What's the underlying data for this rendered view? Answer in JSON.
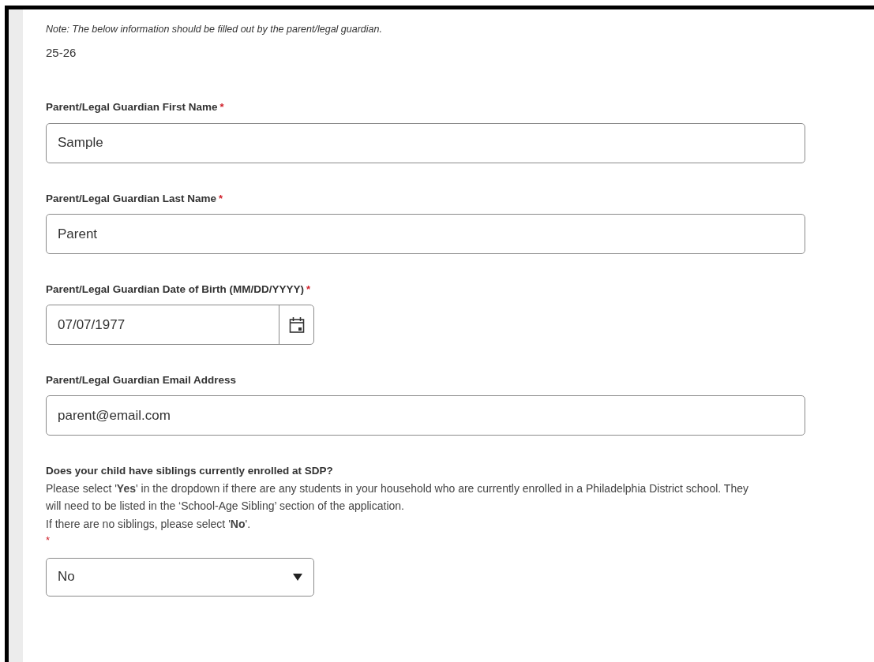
{
  "note": "Note: The below information should be filled out by the parent/legal guardian.",
  "year": "25-26",
  "fields": [
    {
      "kind": "text",
      "label": "Parent/Legal Guardian First Name",
      "required_mark": "*",
      "value": "Sample"
    },
    {
      "kind": "text",
      "label": "Parent/Legal Guardian Last Name",
      "required_mark": "*",
      "value": "Parent"
    },
    {
      "kind": "date",
      "label": "Parent/Legal Guardian Date of Birth (MM/DD/YYYY)",
      "required_mark": "*",
      "value": "07/07/1977"
    },
    {
      "kind": "text",
      "label": "Parent/Legal Guardian Email Address",
      "value": "parent@email.com"
    },
    {
      "kind": "select",
      "label": "Does your child have siblings currently enrolled at SDP?",
      "required_mark": "*",
      "value": "No",
      "description": [
        "Please select '**Yes**' in the dropdown if there are any students in your household who are currently enrolled in a Philadelphia District school. They will need to be listed in the ‘School-Age Sibling’ section of the application.",
        "If there are no siblings, please select '**No**'."
      ]
    }
  ]
}
